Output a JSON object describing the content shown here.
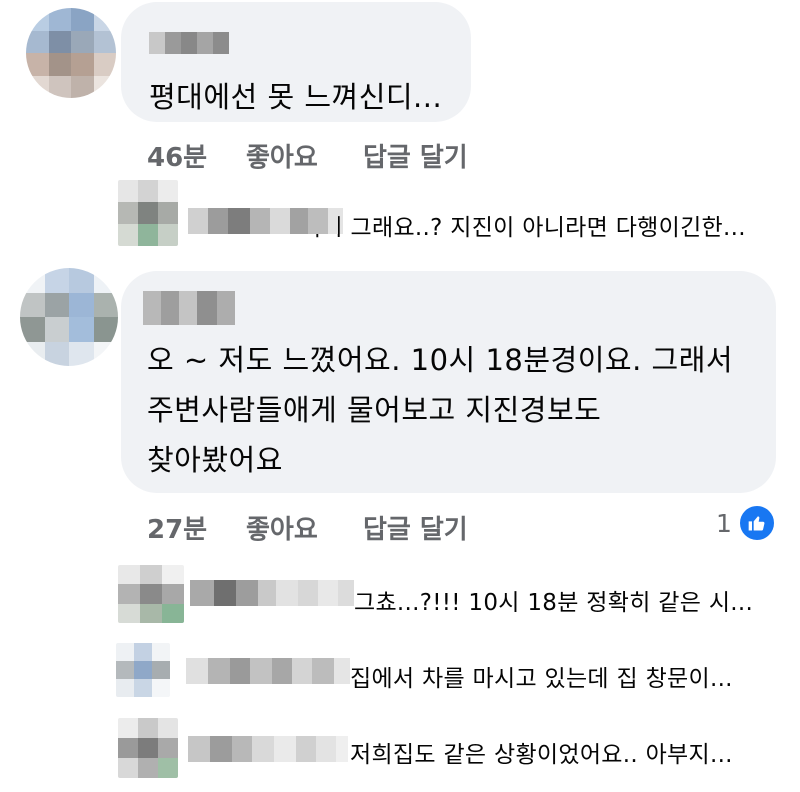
{
  "comments": [
    {
      "text": "평대에선 못 느껴신디...",
      "time": "46분",
      "like_label": "좋아요",
      "reply_label": "답글 달기",
      "replies": [
        {
          "text": "역시 그래요..? 지진이 아니라면 다행이긴한..."
        }
      ]
    },
    {
      "text_lines": [
        "오 ~ 저도 느꼈어요. 10시 18분경이요. 그래서",
        "주변사람들애게 물어보고 지진경보도",
        "찾아봤어요"
      ],
      "time": "27분",
      "like_label": "좋아요",
      "reply_label": "답글 달기",
      "reaction_count": "1",
      "replies": [
        {
          "text": "그쵸...?!!! 10시 18분 정확히 같은 시..."
        },
        {
          "text": "집에서 차를 마시고 있는데 집 창문이..."
        },
        {
          "text": "저희집도 같은 상황이었어요.. 아부지..."
        }
      ]
    }
  ],
  "colors": {
    "bubble": "#f0f2f5",
    "secondary_text": "#65676b",
    "like_blue": "#1877f2"
  },
  "icons": {
    "reaction": "thumbs-up-icon"
  }
}
